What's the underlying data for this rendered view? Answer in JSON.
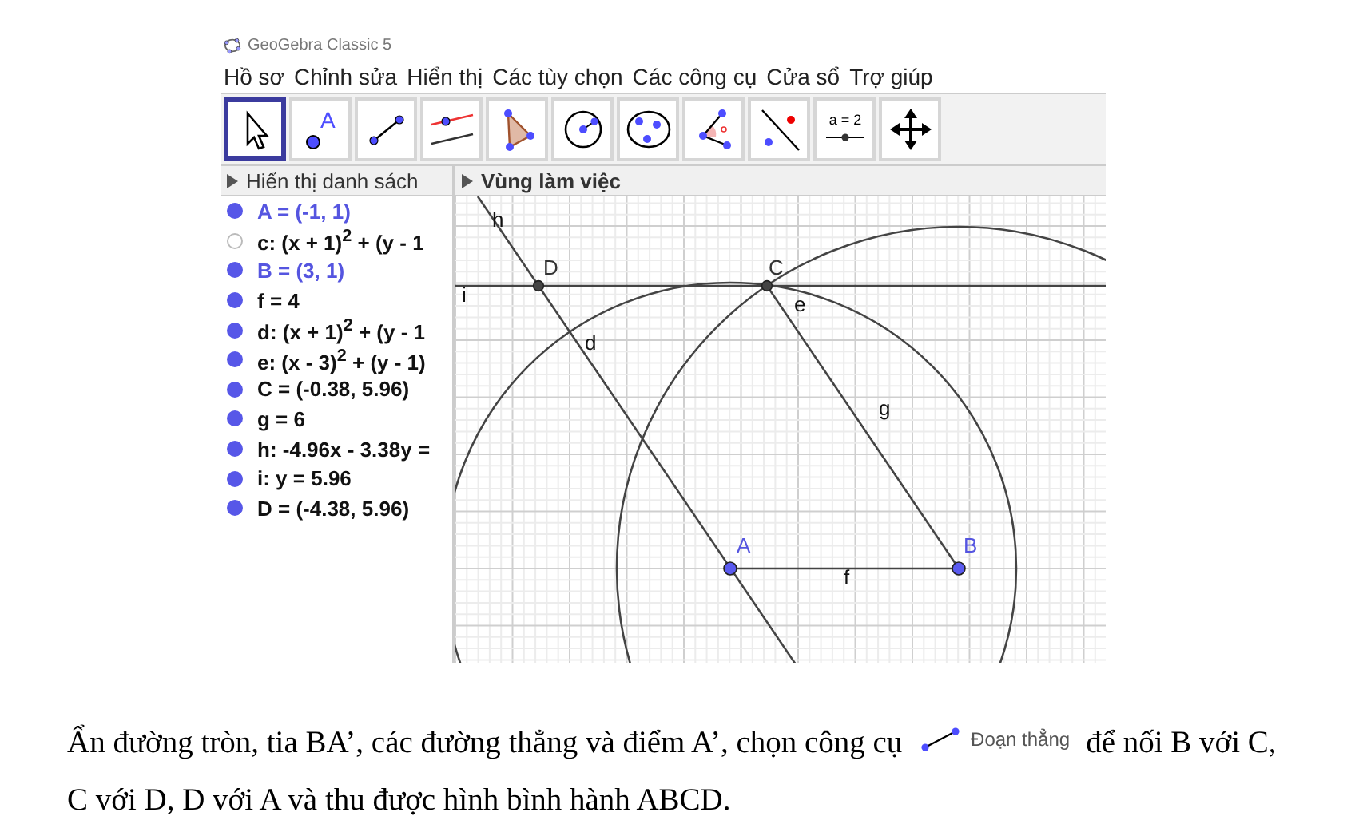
{
  "window": {
    "title": "GeoGebra Classic 5"
  },
  "menu": [
    "Hồ sơ",
    "Chỉnh sửa",
    "Hiển thị",
    "Các tùy chọn",
    "Các công cụ",
    "Cửa sổ",
    "Trợ giúp"
  ],
  "tools": [
    {
      "kind": "move",
      "selected": true
    },
    {
      "kind": "point",
      "label": "A",
      "selected": false
    },
    {
      "kind": "segment",
      "selected": false
    },
    {
      "kind": "parallel",
      "selected": false
    },
    {
      "kind": "polygon",
      "selected": false
    },
    {
      "kind": "circle",
      "selected": false
    },
    {
      "kind": "conic",
      "selected": false
    },
    {
      "kind": "angle",
      "selected": false
    },
    {
      "kind": "reflect",
      "selected": false
    },
    {
      "kind": "slider",
      "label": "a = 2",
      "selected": false
    },
    {
      "kind": "pan",
      "selected": false
    }
  ],
  "algebra": {
    "header": "Hiển thị danh sách",
    "items": [
      {
        "text": "A = (-1, 1)",
        "visible": true,
        "kind": "free"
      },
      {
        "text": "c: (x + 1)$^{2}$ + (y - 1",
        "visible": false,
        "kind": "dependent"
      },
      {
        "text": "B = (3, 1)",
        "visible": true,
        "kind": "free"
      },
      {
        "text": "f = 4",
        "visible": true,
        "kind": "dependent"
      },
      {
        "text": "d: (x + 1)$^{2}$ + (y - 1",
        "visible": true,
        "kind": "dependent"
      },
      {
        "text": "e: (x - 3)$^{2}$ + (y - 1)",
        "visible": true,
        "kind": "dependent"
      },
      {
        "text": "C = (-0.38, 5.96)",
        "visible": true,
        "kind": "dependent"
      },
      {
        "text": "g = 6",
        "visible": true,
        "kind": "dependent"
      },
      {
        "text": "h: -4.96x - 3.38y =",
        "visible": true,
        "kind": "dependent"
      },
      {
        "text": "i: y = 5.96",
        "visible": true,
        "kind": "dependent"
      },
      {
        "text": "D = (-4.38, 5.96)",
        "visible": true,
        "kind": "dependent"
      }
    ]
  },
  "graphics": {
    "header": "Vùng làm việc",
    "points": [
      {
        "name": "A",
        "kind": "free"
      },
      {
        "name": "B",
        "kind": "free"
      },
      {
        "name": "C",
        "kind": "dependent"
      },
      {
        "name": "D",
        "kind": "dependent"
      }
    ],
    "object_labels": [
      "h",
      "i",
      "d",
      "e",
      "g",
      "f"
    ]
  },
  "instruction": {
    "before": "Ẩn đường tròn, tia BA’, các đường thẳng và điểm A’, chọn công cụ",
    "tool_label": "Đoạn thẳng",
    "after": "để nối B với C, C với D, D với A và thu được hình bình hành ABCD."
  }
}
